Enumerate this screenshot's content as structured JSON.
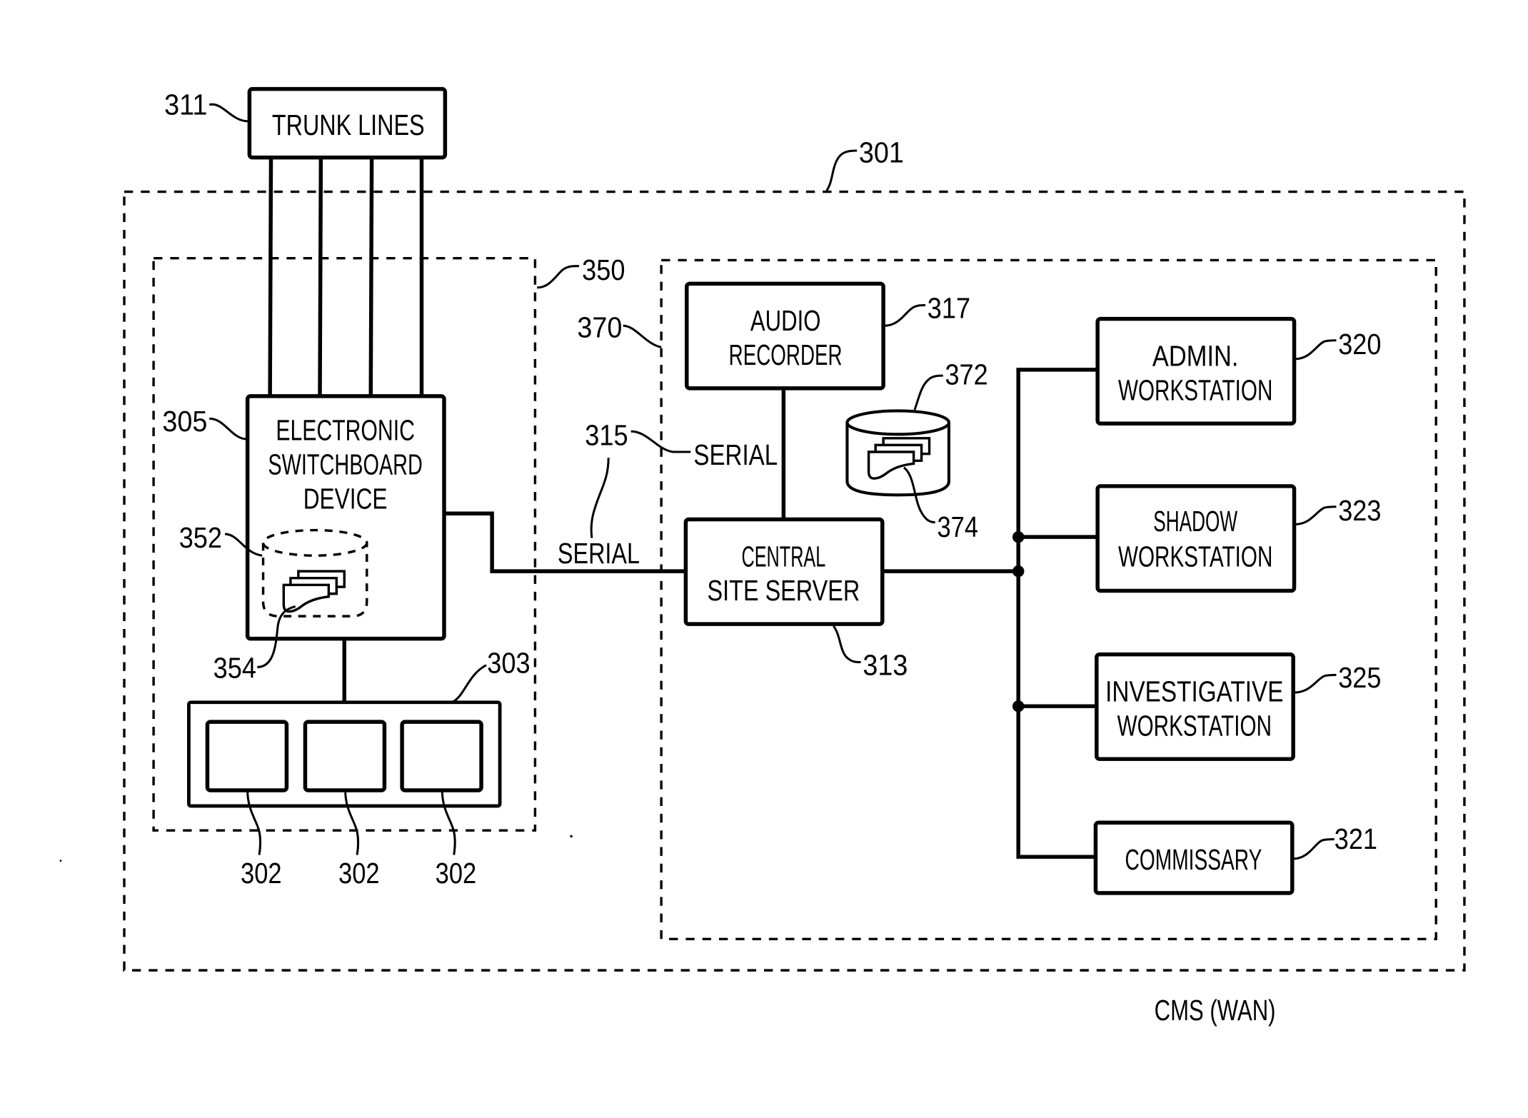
{
  "diagram": {
    "blocks": {
      "trunk_lines": {
        "label_lines": [
          "TRUNK LINES"
        ],
        "ref": "311"
      },
      "switchboard": {
        "label_lines": [
          "ELECTRONIC",
          "SWITCHBOARD",
          "DEVICE"
        ],
        "ref": "305"
      },
      "audio_recorder": {
        "label_lines": [
          "AUDIO",
          "RECORDER"
        ],
        "ref": "317"
      },
      "central_server": {
        "label_lines": [
          "CENTRAL",
          "SITE SERVER"
        ],
        "ref": "313"
      },
      "admin_ws": {
        "label_lines": [
          "ADMIN.",
          "WORKSTATION"
        ],
        "ref": "320"
      },
      "shadow_ws": {
        "label_lines": [
          "SHADOW",
          "WORKSTATION"
        ],
        "ref": "323"
      },
      "investigative_ws": {
        "label_lines": [
          "INVESTIGATIVE",
          "WORKSTATION"
        ],
        "ref": "325"
      },
      "commissary": {
        "label_lines": [
          "COMMISSARY"
        ],
        "ref": "321"
      },
      "phone_bank": {
        "ref": "303"
      },
      "phones": {
        "ref": "302"
      }
    },
    "regions": {
      "outer": {
        "ref": "301"
      },
      "site_left": {
        "ref": "350"
      },
      "site_right": {
        "ref": "370"
      }
    },
    "storage": {
      "switch_db": {
        "ref": "352"
      },
      "switch_records": {
        "ref": "354"
      },
      "server_db": {
        "ref": "372"
      },
      "server_records": {
        "ref": "374"
      }
    },
    "links": {
      "serial_ref": "315",
      "serial_label_1": "SERIAL",
      "serial_label_2": "SERIAL"
    },
    "caption": "CMS (WAN)"
  }
}
